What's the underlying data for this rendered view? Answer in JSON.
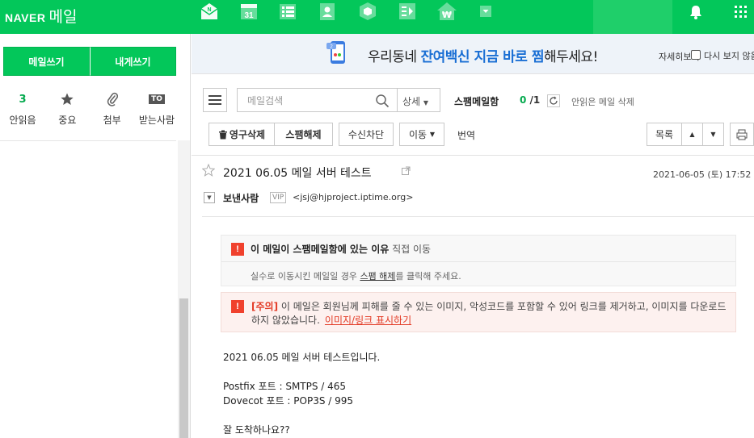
{
  "header": {
    "brand": "NAVER",
    "service": "메일",
    "apps": [
      {
        "icon": "mail-app-icon",
        "text": "N"
      },
      {
        "icon": "calendar-app-icon",
        "text": "31"
      },
      {
        "icon": "list-app-icon",
        "text": ""
      },
      {
        "icon": "contacts-app-icon",
        "text": ""
      },
      {
        "icon": "box-app-icon",
        "text": ""
      },
      {
        "icon": "memo-app-icon",
        "text": ""
      },
      {
        "icon": "household-app-icon",
        "text": "₩"
      },
      {
        "icon": "more-apps-icon",
        "text": ""
      }
    ]
  },
  "sidebar": {
    "write_mail": "메일쓰기",
    "write_to_self": "내게쓰기",
    "quick": [
      {
        "count": "3",
        "label": "안읽음",
        "icon": "unread-count"
      },
      {
        "label": "중요",
        "icon": "star-icon"
      },
      {
        "label": "첨부",
        "icon": "paperclip-icon"
      },
      {
        "badge": "TO",
        "label": "받는사람",
        "icon": "to-badge-icon"
      }
    ]
  },
  "banner": {
    "text_pre": "우리동네 ",
    "text_highlight": "잔여백신 지금 바로 찜",
    "text_post": "해두세요!",
    "detail": "자세히보기",
    "no_show": "다시 보지 않음"
  },
  "toolbar": {
    "search_placeholder": "메일검색",
    "detail_search": "상세",
    "folder_name": "스팸메일함",
    "unread": "0",
    "total": "/1",
    "delete_unread": "안읽은 메일 삭제",
    "perm_delete": "영구삭제",
    "unspam": "스팸해제",
    "block": "수신차단",
    "move": "이동",
    "translate": "번역",
    "list": "목록"
  },
  "mail": {
    "subject": "2021 06.05 메일 서버 테스트",
    "date": "2021-06-05 (토) 17:52",
    "sender_label": "보낸사람",
    "vip": "VIP",
    "sender_address": "<jsj@hjproject.iptime.org>",
    "spam_reason_title": "이 메일이 스팸메일함에 있는 이유",
    "spam_reason_detail": "직접 이동",
    "spam_hint_pre": "실수로 이동시킨 메일일 경우 ",
    "spam_hint_link": "스팸 해제",
    "spam_hint_post": "를 클릭해 주세요.",
    "warn_tag": "[주의]",
    "warn_text": "이 메일은 회원님께 피해를 줄 수 있는 이미지, 악성코드를 포함할 수 있어 링크를 제거하고, 이미지를 다운로드하지 않았습니다.",
    "warn_link": "이미지/링크 표시하기",
    "body": {
      "line1": "2021 06.05 메일 서버 테스트입니다.",
      "line2": "Postfix 포트 : SMTPS / 465",
      "line3": "Dovecot 포트 : POP3S / 995",
      "line4": "잘 도착하나요??"
    }
  },
  "colors": {
    "brand_green": "#03c75a",
    "warning_red": "#f0412d",
    "banner_blue": "#1a6fd4"
  }
}
